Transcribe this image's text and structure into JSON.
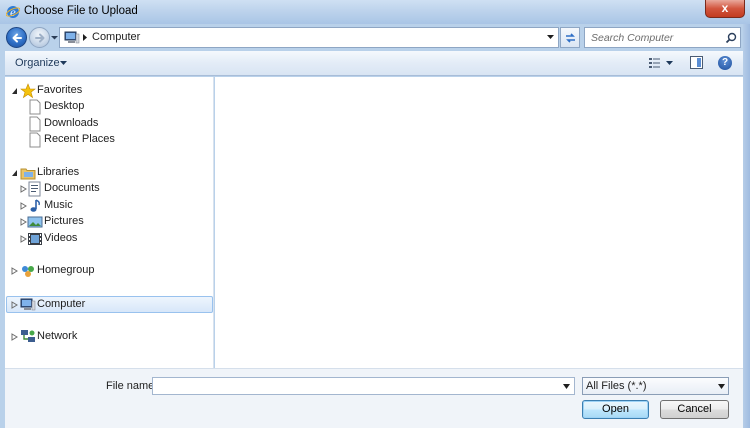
{
  "window": {
    "title": "Choose File to Upload",
    "close_label": "x"
  },
  "address": {
    "location": "Computer",
    "search_placeholder": "Search Computer"
  },
  "toolbar": {
    "organize_label": "Organize"
  },
  "nav": {
    "favorites": {
      "label": "Favorites",
      "items": [
        "Desktop",
        "Downloads",
        "Recent Places"
      ]
    },
    "libraries": {
      "label": "Libraries",
      "items": [
        "Documents",
        "Music",
        "Pictures",
        "Videos"
      ]
    },
    "homegroup": "Homegroup",
    "computer": "Computer",
    "network": "Network"
  },
  "bottom": {
    "file_name_label": "File name:",
    "file_name_value": "",
    "filter_value": "All Files (*.*)",
    "open_label": "Open",
    "cancel_label": "Cancel"
  }
}
